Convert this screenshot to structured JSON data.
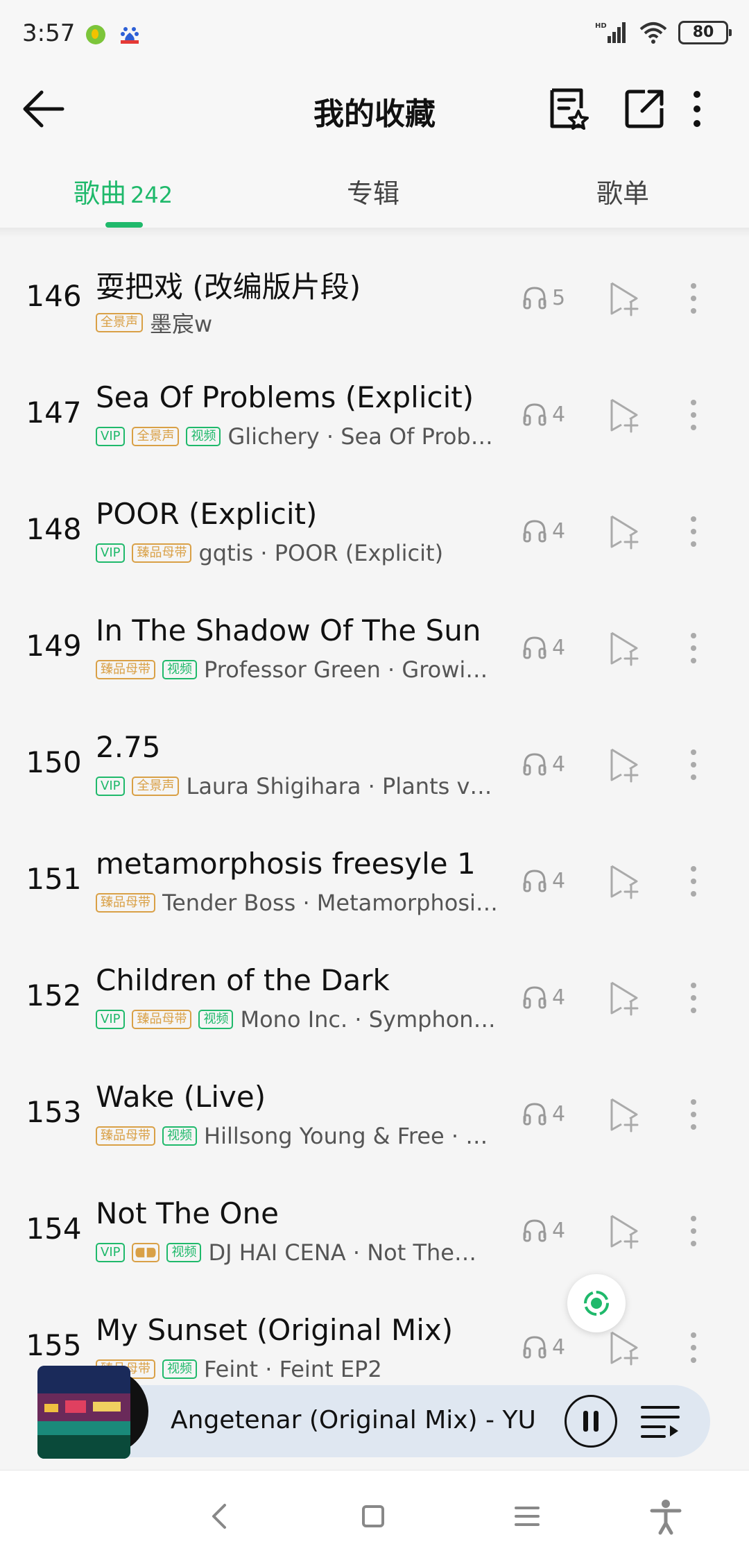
{
  "status": {
    "time": "3:57",
    "battery": "80",
    "network": "HD"
  },
  "header": {
    "title": "我的收藏"
  },
  "tabs": [
    {
      "label": "歌曲",
      "count": "242"
    },
    {
      "label": "专辑"
    },
    {
      "label": "歌单"
    }
  ],
  "badge_labels": {
    "vip": "VIP",
    "all": "全景声",
    "master": "臻品母带",
    "video": "视频"
  },
  "songs": [
    {
      "index": "146",
      "title": "耍把戏 (改编版片段)",
      "artist": "墨宸w",
      "plays": "5"
    },
    {
      "index": "147",
      "title": "Sea Of Problems (Explicit)",
      "artist": "Glichery · Sea Of Prob…",
      "plays": "4"
    },
    {
      "index": "148",
      "title": "POOR (Explicit)",
      "artist": "gqtis · POOR (Explicit)",
      "plays": "4"
    },
    {
      "index": "149",
      "title": "In The Shadow Of The Sun",
      "artist": "Professor Green · Growin…",
      "plays": "4"
    },
    {
      "index": "150",
      "title": "2.75",
      "artist": "Laura Shigihara · Plants vs…",
      "plays": "4"
    },
    {
      "index": "151",
      "title": "metamorphosis freesyle 1",
      "artist": "Tender Boss · Metamorphosi…",
      "plays": "4"
    },
    {
      "index": "152",
      "title": "Children of the Dark",
      "artist": "Mono Inc. · Symphon…",
      "plays": "4"
    },
    {
      "index": "153",
      "title": "Wake (Live)",
      "artist": "Hillsong Young & Free · …",
      "plays": "4"
    },
    {
      "index": "154",
      "title": "Not The One",
      "artist": "DJ HAI CENA · Not The…",
      "plays": "4"
    },
    {
      "index": "155",
      "title": "My Sunset (Original Mix)",
      "artist": "Feint · Feint EP2",
      "plays": "4"
    }
  ],
  "player": {
    "title": "Angetenar (Original Mix) - YUN/"
  },
  "colors": {
    "accent": "#1fb96b",
    "gold": "#d9a046"
  }
}
